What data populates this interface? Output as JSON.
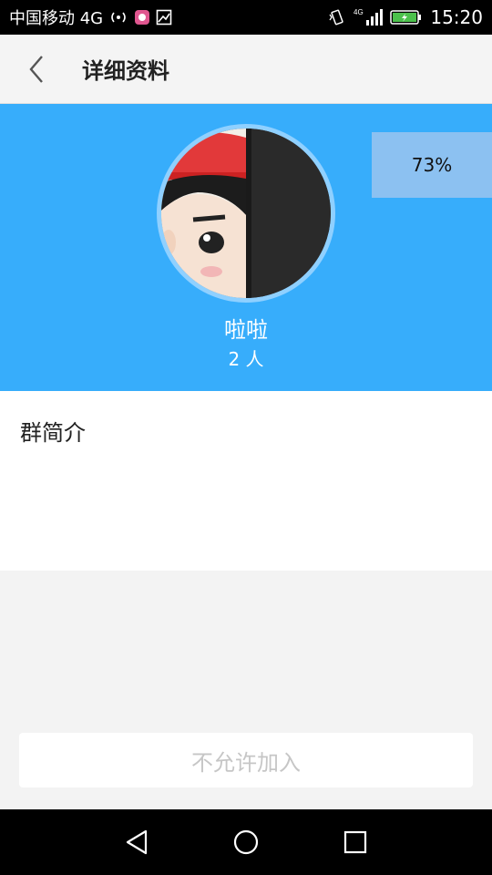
{
  "status_bar": {
    "carrier": "中国移动 4G",
    "network_type": "4G",
    "time": "15:20",
    "icons": [
      "broadcast-icon",
      "app-notification-icon",
      "image-icon",
      "vibrate-icon",
      "signal-icon",
      "battery-charging-icon"
    ]
  },
  "header": {
    "title": "详细资料",
    "back_icon": "chevron-left-icon"
  },
  "profile": {
    "group_name": "啦啦",
    "member_count": "2 人",
    "progress_label": "73%",
    "progress_value": 0.73,
    "background_color": "#37adfb"
  },
  "intro": {
    "label": "群简介",
    "content": ""
  },
  "join_button": {
    "label": "不允许加入"
  },
  "nav_bar": {
    "icons": [
      "back-triangle-icon",
      "home-circle-icon",
      "recents-square-icon"
    ]
  }
}
